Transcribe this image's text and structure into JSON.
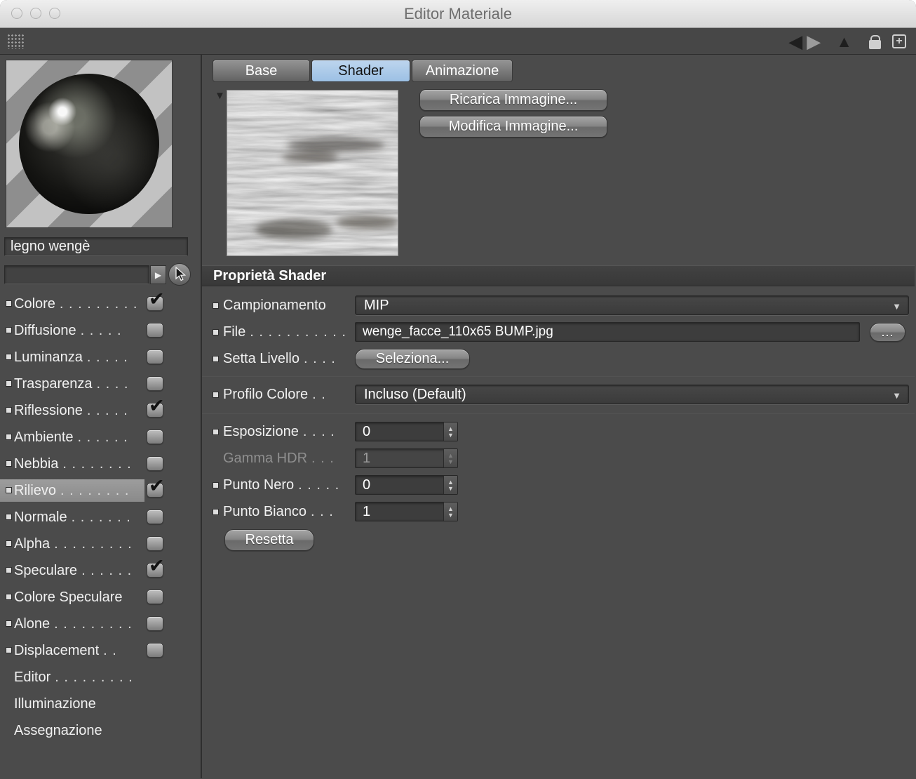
{
  "window": {
    "title": "Editor Materiale"
  },
  "colors": {
    "active_tab": "#a9c7e6",
    "panel_bg": "#4b4b4b"
  },
  "icons": {
    "check": "✔",
    "dropdown_arrow": "▼",
    "disclosure": "▼",
    "back": "◀",
    "forward": "▶",
    "up": "▲",
    "spin_up": "▲",
    "spin_down": "▼",
    "menu_arrow": "▶",
    "plus": "+",
    "browse_ellipsis": "..."
  },
  "left_panel": {
    "material_name": "legno wengè",
    "channels": [
      {
        "label": "Colore",
        "dots": ". . . . . . . . .",
        "checked": true
      },
      {
        "label": "Diffusione",
        "dots": ". . . . .",
        "checked": false
      },
      {
        "label": "Luminanza",
        "dots": ". . . . .",
        "checked": false
      },
      {
        "label": "Trasparenza",
        "dots": ". . . .",
        "checked": false
      },
      {
        "label": "Riflessione",
        "dots": ". . . . .",
        "checked": true
      },
      {
        "label": "Ambiente",
        "dots": ". . . . . .",
        "checked": false
      },
      {
        "label": "Nebbia",
        "dots": ". . . . . . . .",
        "checked": false
      },
      {
        "label": "Rilievo",
        "dots": ". . . . . . . .",
        "checked": true,
        "selected": true
      },
      {
        "label": "Normale",
        "dots": ". . . . . . .",
        "checked": false
      },
      {
        "label": "Alpha",
        "dots": ". . . . . . . . .",
        "checked": false
      },
      {
        "label": "Speculare",
        "dots": ". . . . . .",
        "checked": true
      },
      {
        "label": "Colore Speculare",
        "dots": "",
        "checked": false
      },
      {
        "label": "Alone",
        "dots": ". . . . . . . . .",
        "checked": false
      },
      {
        "label": "Displacement",
        "dots": ". .",
        "checked": false
      },
      {
        "label": "Editor",
        "dots": ". . . . . . . . ."
      },
      {
        "label": "Illuminazione",
        "dots": ""
      },
      {
        "label": "Assegnazione",
        "dots": ""
      }
    ]
  },
  "tabs": {
    "base": "Base",
    "shader": "Shader",
    "animazione": "Animazione"
  },
  "shader_panel": {
    "reload_button": "Ricarica Immagine...",
    "edit_button": "Modifica Immagine...",
    "section_title": "Proprietà Shader",
    "campionamento": {
      "label": "Campionamento",
      "dots": "",
      "value": "MIP"
    },
    "file": {
      "label": "File",
      "dots": ". . . . . . . . . . .",
      "value": "wenge_facce_110x65 BUMP.jpg"
    },
    "setta_livello": {
      "label": "Setta Livello",
      "dots": ". . . .",
      "button": "Seleziona..."
    },
    "profilo_colore": {
      "label": "Profilo Colore",
      "dots": ". .",
      "value": "Incluso (Default)"
    },
    "esposizione": {
      "label": "Esposizione",
      "dots": ". . . .",
      "value": "0"
    },
    "gamma_hdr": {
      "label": "Gamma HDR",
      "dots": ". . .",
      "value": "1"
    },
    "punto_nero": {
      "label": "Punto Nero",
      "dots": ". . . . .",
      "value": "0"
    },
    "punto_bianco": {
      "label": "Punto Bianco",
      "dots": ". . .",
      "value": "1"
    },
    "reset_button": "Resetta"
  }
}
